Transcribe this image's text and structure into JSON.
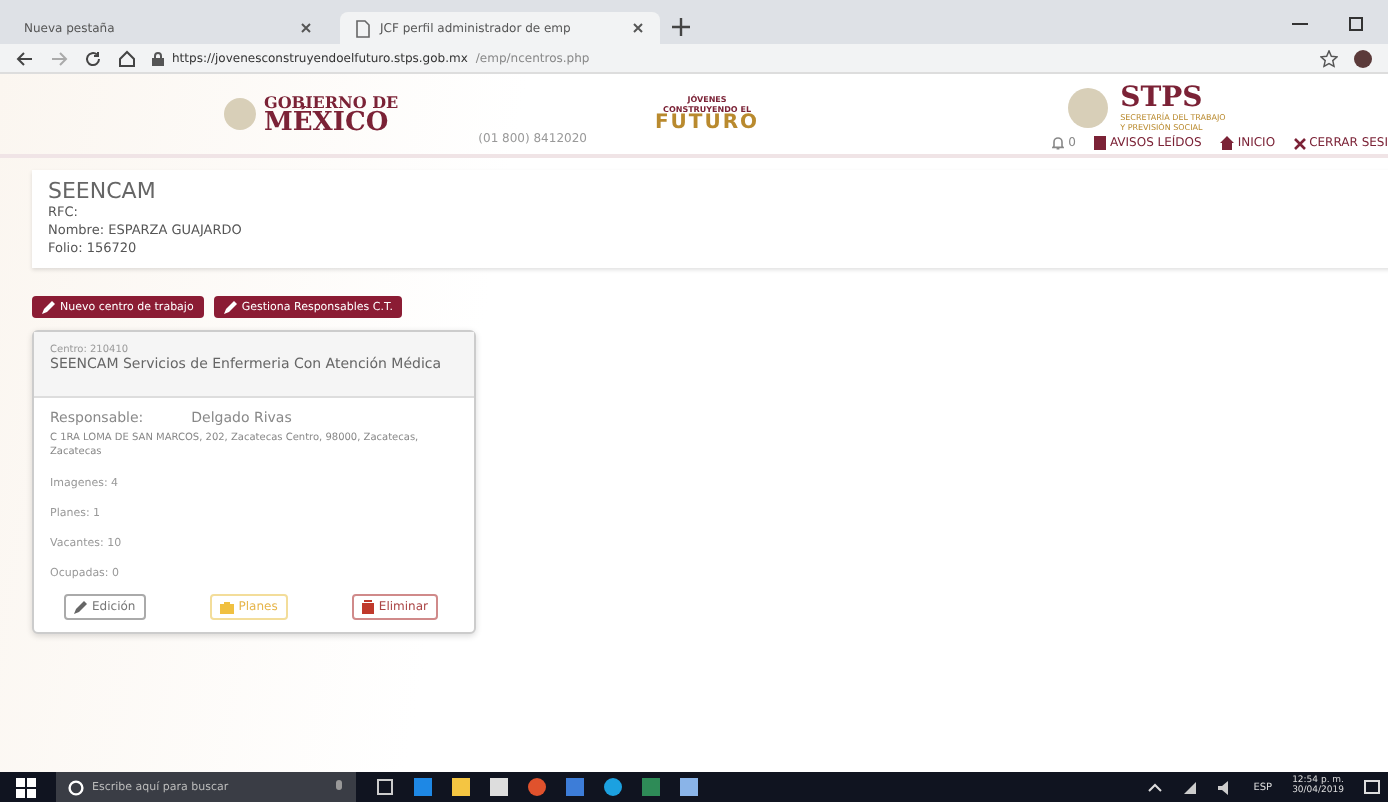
{
  "browser": {
    "tabs": [
      {
        "title": "Nueva pestaña",
        "selected": false
      },
      {
        "title": "JCF perfil administrador de emp",
        "selected": true
      }
    ],
    "url_host": "https://jovenesconstruyendoelfuturo.stps.gob.mx",
    "url_path": "/emp/ncentros.php"
  },
  "header": {
    "gob_line1": "GOBIERNO DE",
    "gob_line2": "MÉXICO",
    "phone": "(01 800) 8412020",
    "jcf_line1": "JÓVENES",
    "jcf_line2": "CONSTRUYENDO EL",
    "jcf_line3": "FUTURO",
    "stps": "STPS",
    "stps_sub1": "SECRETARÍA DEL TRABAJO",
    "stps_sub2": "Y PREVISIÓN SOCIAL",
    "nav": [
      {
        "kind": "bell",
        "label": "0"
      },
      {
        "kind": "notes",
        "label": "AVISOS LEÍDOS"
      },
      {
        "kind": "home",
        "label": "INICIO"
      },
      {
        "kind": "close",
        "label": "CERRAR SESI"
      }
    ]
  },
  "company": {
    "name": "SEENCAM",
    "rfc": "RFC:",
    "nombre": "Nombre: ESPARZA GUAJARDO",
    "folio": "Folio: 156720"
  },
  "actions": [
    "Nuevo centro de trabajo",
    "Gestiona Responsables C.T."
  ],
  "center": {
    "id": "Centro: 210410",
    "title": "SEENCAM Servicios de Enfermeria Con Atención Médica",
    "responsable_label": "Responsable:",
    "responsable": "Delgado Rivas",
    "address": "C 1RA LOMA DE SAN MARCOS, 202, Zacatecas Centro, 98000, Zacatecas, Zacatecas",
    "stats": [
      "Imagenes: 4",
      "Planes: 1",
      "Vacantes: 10",
      "Ocupadas: 0"
    ],
    "buttons": [
      {
        "kind": "edit",
        "label": "Edición"
      },
      {
        "kind": "plans",
        "label": "Planes"
      },
      {
        "kind": "delete",
        "label": "Eliminar"
      }
    ]
  },
  "taskbar": {
    "search_placeholder": "Escribe aquí para buscar",
    "lang": "ESP",
    "time": "12:54 p. m.",
    "date": "30/04/2019"
  }
}
